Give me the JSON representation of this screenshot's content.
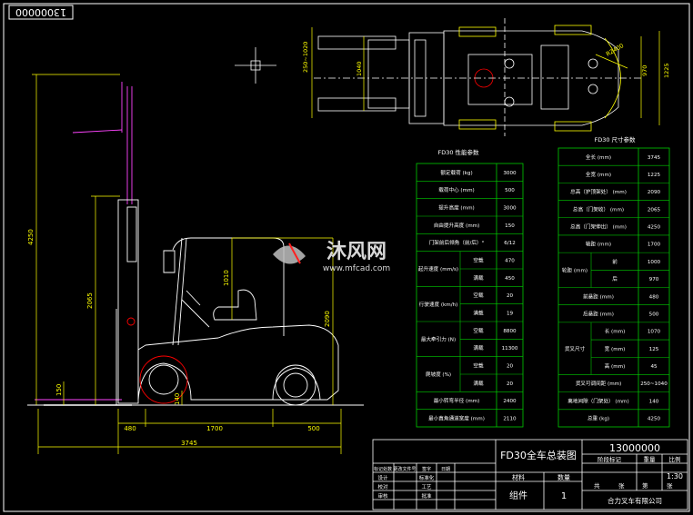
{
  "drawing_number_top": "13000000",
  "perf_table": {
    "title": "FD30 性能参数",
    "rows": [
      {
        "label": "额定载荷    (kg)",
        "value": "3000"
      },
      {
        "label": "载荷中心    (mm)",
        "value": "500"
      },
      {
        "label": "提升高度    (mm)",
        "value": "3000"
      },
      {
        "label": "自由提升高度   (mm)",
        "value": "150"
      },
      {
        "label": "门架前后倾角（前/后）°",
        "value": "6/12"
      },
      {
        "label": "起升速度  (mm/s)",
        "sub": "空载",
        "value": "470"
      },
      {
        "label": "",
        "sub": "满载",
        "value": "450"
      },
      {
        "label": "行驶速度  (km/h)",
        "sub": "空载",
        "value": "20"
      },
      {
        "label": "",
        "sub": "满载",
        "value": "19"
      },
      {
        "label": "最大牵引力 (N)",
        "sub": "空载",
        "value": "8800"
      },
      {
        "label": "",
        "sub": "满载",
        "value": "11300"
      },
      {
        "label": "爬坡度  (%)",
        "sub": "空载",
        "value": "20"
      },
      {
        "label": "",
        "sub": "满载",
        "value": "20"
      },
      {
        "label": "最小转弯半径   (mm)",
        "value": "2400"
      },
      {
        "label": "最小直角通道宽度  (mm)",
        "value": "2110"
      }
    ]
  },
  "dim_table": {
    "title": "FD30 尺寸参数",
    "rows": [
      {
        "label": "全长    (mm)",
        "value": "3745"
      },
      {
        "label": "全宽    (mm)",
        "value": "1225"
      },
      {
        "label": "总高（护顶架处）  (mm)",
        "value": "2090"
      },
      {
        "label": "总高（门架收）  (mm)",
        "value": "2065"
      },
      {
        "label": "总高（门架伸出）  (mm)",
        "value": "4250"
      },
      {
        "label": "轴距    (mm)",
        "value": "1700"
      },
      {
        "label": "轮距   (mm)",
        "sub": "前",
        "value": "1000"
      },
      {
        "label": "",
        "sub": "后",
        "value": "970"
      },
      {
        "label": "前悬距   (mm)",
        "value": "480"
      },
      {
        "label": "后悬距   (mm)",
        "value": "500"
      },
      {
        "label": "货叉尺寸",
        "sub": "长  (mm)",
        "value": "1070"
      },
      {
        "label": "",
        "sub": "宽  (mm)",
        "value": "125"
      },
      {
        "label": "",
        "sub": "高  (mm)",
        "value": "45"
      },
      {
        "label": "货叉可调间距   (mm)",
        "value": "250~1040"
      },
      {
        "label": "离地间隙（门架处）  (mm)",
        "value": "140"
      },
      {
        "label": "总重    (kg)",
        "value": "4250"
      }
    ]
  },
  "dimensions": {
    "overall_length": "3745",
    "front_overhang": "480",
    "wheelbase": "1700",
    "rear_overhang": "500",
    "mast_extended_height": "4250",
    "mast_lowered_height": "2065",
    "overhead_guard_height": "2090",
    "seat_height": "1010",
    "fork_height": "150",
    "ground_clearance": "140",
    "top_view_width": "1040",
    "top_view_fork_spacing": "250~1020",
    "top_view_rear_track": "970",
    "top_view_width_total": "1225",
    "turn_radius": "R2400"
  },
  "title_block": {
    "drawing_title": "FD30全车总装图",
    "drawing_number": "13000000",
    "headers": [
      "阶段标记",
      "重量",
      "比例"
    ],
    "scale": "1:30",
    "revision_labels": [
      "标记处数",
      "更改文件号",
      "签字",
      "日期"
    ],
    "sign_labels": [
      "设计",
      "校对",
      "审核",
      "标准化",
      "工艺",
      "批准"
    ],
    "material_header": "材料",
    "quantity_header": "数量",
    "material_value": "组件",
    "quantity_value": "1",
    "sheet_info": [
      "共",
      "张",
      "第",
      "张"
    ],
    "company": "合力叉车有限公司"
  },
  "watermark": {
    "brand": "沐风网",
    "url": "www.mfcad.com"
  },
  "colors": {
    "background": "#000000",
    "line_yellow": "#ffff00",
    "line_white": "#ffffff",
    "line_green": "#00ff00",
    "line_magenta": "#ff44ff",
    "line_red": "#ff0000",
    "table_border": "#00cc00"
  }
}
